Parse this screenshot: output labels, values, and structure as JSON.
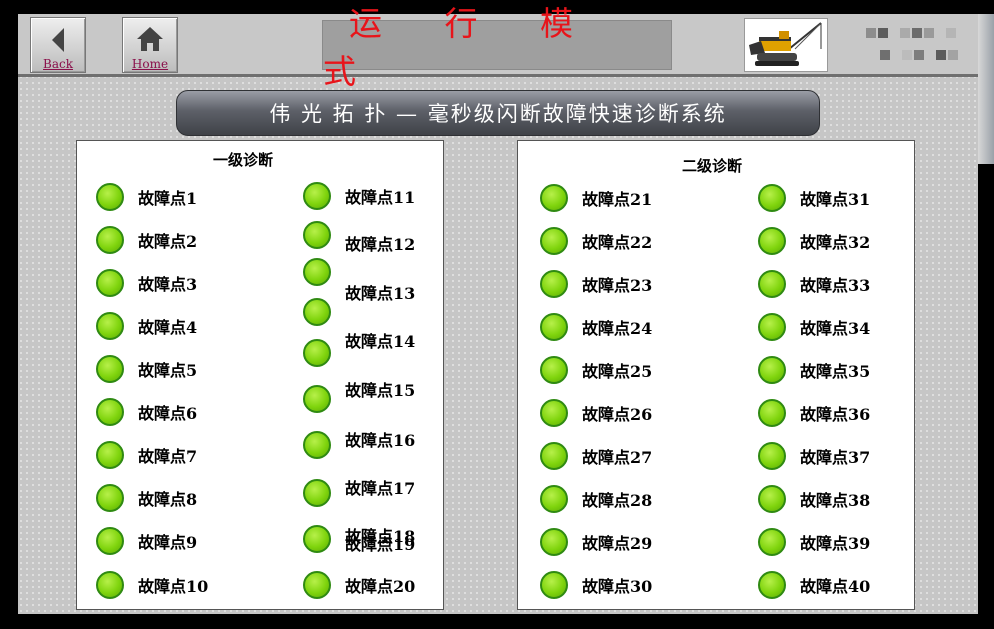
{
  "nav": {
    "back_label": "Back",
    "home_label": "Home"
  },
  "header": {
    "mode_title": "运 行 模 式"
  },
  "system_title": "伟 光 拓 扑 — 毫秒级闪断故障快速诊断系统",
  "colors": {
    "led_ok": "#7fd40d",
    "mode_text": "#e8141a",
    "led_border": "#2f8a12"
  },
  "panels": {
    "level1": {
      "title": "一级诊断",
      "col1": [
        "故障点1",
        "故障点2",
        "故障点3",
        "故障点4",
        "故障点5",
        "故障点6",
        "故障点7",
        "故障点8",
        "故障点9",
        "故障点10"
      ],
      "col2": [
        "故障点11",
        "故障点12",
        "故障点13",
        "故障点14",
        "故障点15",
        "故障点16",
        "故障点17",
        "故障点18",
        "故障点19",
        "故障点20"
      ]
    },
    "level2": {
      "title": "二级诊断",
      "col1": [
        "故障点21",
        "故障点22",
        "故障点23",
        "故障点24",
        "故障点25",
        "故障点26",
        "故障点27",
        "故障点28",
        "故障点29",
        "故障点30"
      ],
      "col2": [
        "故障点31",
        "故障点32",
        "故障点33",
        "故障点34",
        "故障点35",
        "故障点36",
        "故障点37",
        "故障点38",
        "故障点39",
        "故障点40"
      ]
    }
  }
}
